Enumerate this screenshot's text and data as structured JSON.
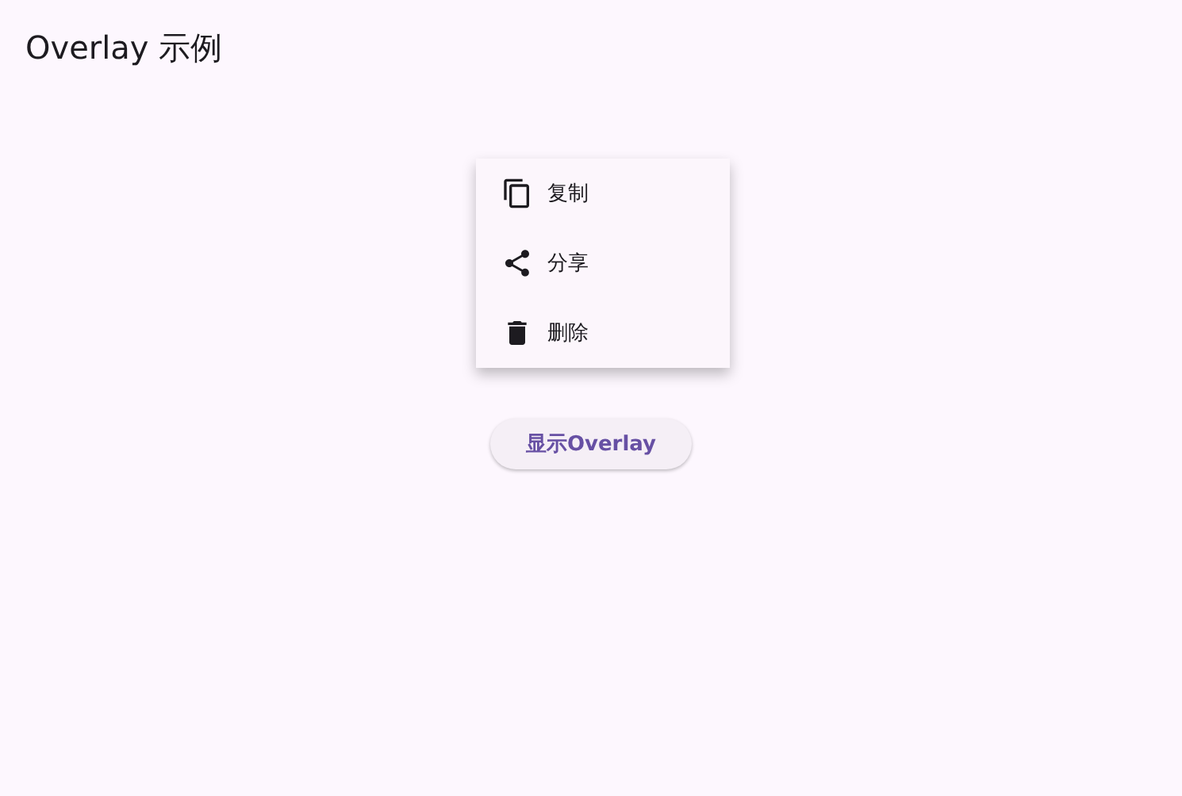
{
  "title": "Overlay 示例",
  "menu": [
    {
      "kind": "copy",
      "label": "复制"
    },
    {
      "kind": "share",
      "label": "分享"
    },
    {
      "kind": "delete",
      "label": "删除"
    }
  ],
  "button": "显示Overlay"
}
